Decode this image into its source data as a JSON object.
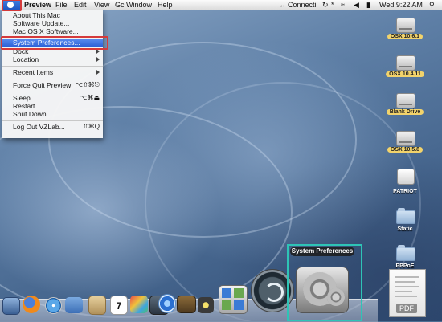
{
  "menubar": {
    "apple_icon": "apple-logo",
    "app_name": "Preview",
    "menus": [
      "File",
      "Edit",
      "View",
      "Gc",
      "Window",
      "Help"
    ],
    "status_connection": "Connecti",
    "clock": "Wed 9:22 AM"
  },
  "apple_menu": {
    "items": [
      {
        "label": "About This Mac"
      },
      {
        "label": "Software Update..."
      },
      {
        "label": "Mac OS X Software..."
      },
      {
        "label": "System Preferences..."
      },
      {
        "label": "Dock"
      },
      {
        "label": "Location"
      },
      {
        "label": "Recent Items"
      },
      {
        "label": "Force Quit Preview",
        "shortcut": "⌥⇧⌘⎋"
      },
      {
        "label": "Sleep",
        "shortcut": "⌥⌘⏏"
      },
      {
        "label": "Restart..."
      },
      {
        "label": "Shut Down..."
      },
      {
        "label": "Log Out VZLab...",
        "shortcut": "⇧⌘Q"
      }
    ],
    "selected": "System Preferences..."
  },
  "desktop_icons": [
    {
      "label": "OSX 10.6.1",
      "kind": "hard-drive-icon"
    },
    {
      "label": "OSX 10.4.11",
      "kind": "hard-drive-icon"
    },
    {
      "label": "Blank Drive",
      "kind": "hard-drive-icon"
    },
    {
      "label": "OSX 10.5.8",
      "kind": "hard-drive-icon"
    },
    {
      "label": "PATRIOT",
      "kind": "usb-drive-icon"
    },
    {
      "label": "Static",
      "kind": "folder-icon"
    },
    {
      "label": "PPPoE",
      "kind": "folder-icon"
    }
  ],
  "dock": {
    "tooltip": "System Preferences",
    "calendar_day": "7",
    "pdf_label": "PDF",
    "highlight_color": "#2ec4b6"
  },
  "colors": {
    "menu_selection": "#2c62d8",
    "annotation_red": "#d53a3a",
    "drive_label_yellow": "#f2d36b"
  }
}
